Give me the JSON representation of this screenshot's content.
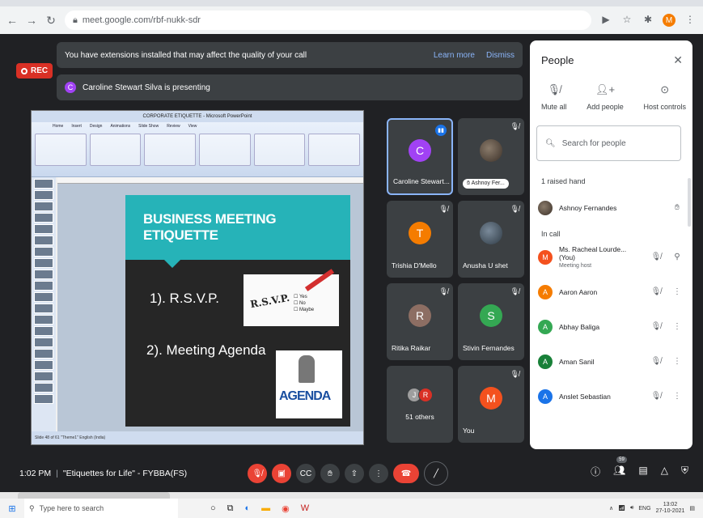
{
  "browser": {
    "url": "meet.google.com/rbf-nukk-sdr",
    "profile_initial": "M"
  },
  "rec_label": "REC",
  "banners": {
    "extensions": "You have extensions installed that may affect the quality of your call",
    "learn_more": "Learn more",
    "dismiss": "Dismiss",
    "presenter_initial": "C",
    "presenting": "Caroline Stewart Silva is presenting"
  },
  "presentation": {
    "window_title": "CORPORATE ETIQUETTE - Microsoft PowerPoint",
    "ribbon_tabs": [
      "Home",
      "Insert",
      "Design",
      "Animations",
      "Slide Show",
      "Review",
      "View"
    ],
    "slide_title": "BUSINESS MEETING ETIQUETTE",
    "item1": "1). R.S.V.P.",
    "item2": "2). Meeting Agenda",
    "rsvp_title": "R.S.V.P.",
    "rsvp_options": [
      "Yes",
      "No",
      "Maybe"
    ],
    "agenda_image_text": "AGENDA",
    "status": "Slide 48 of 61   \"Theme1\"   English (India)"
  },
  "tiles": [
    {
      "name": "Caroline Stewart...",
      "initial": "C",
      "color": "#a142f4"
    },
    {
      "name": "Ashnoy Fer..."
    },
    {
      "name": "Trishia D'Mello",
      "initial": "T",
      "color": "#f57c00"
    },
    {
      "name": "Anusha U shet"
    },
    {
      "name": "Ritika Raikar",
      "initial": "R",
      "color": "#8d6e63"
    },
    {
      "name": "Stivin Fernandes",
      "initial": "S",
      "color": "#34a853"
    },
    {
      "name": "51 others",
      "initials": [
        "J",
        "R"
      ]
    },
    {
      "name": "You",
      "initial": "M",
      "color": "#f4511e"
    }
  ],
  "people_panel": {
    "title": "People",
    "actions": [
      {
        "label": "Mute all",
        "icon": "mic-off-icon"
      },
      {
        "label": "Add people",
        "icon": "add-person-icon"
      },
      {
        "label": "Host controls",
        "icon": "host-controls-icon"
      }
    ],
    "search_placeholder": "Search for people",
    "raised_hand_label": "1 raised hand",
    "raised": {
      "name": "Ashnoy Fernandes"
    },
    "in_call_label": "In call",
    "people": [
      {
        "name": "Ms. Racheal Lourde... (You)",
        "sub": "Meeting host",
        "initial": "M",
        "color": "#f4511e"
      },
      {
        "name": "Aaron Aaron",
        "initial": "A",
        "color": "#f57c00"
      },
      {
        "name": "Abhay Baliga",
        "initial": "A",
        "color": "#34a853"
      },
      {
        "name": "Aman Sanil",
        "initial": "A",
        "color": "#188038"
      },
      {
        "name": "Anslet Sebastian",
        "initial": "A",
        "color": "#1a73e8"
      }
    ]
  },
  "controls": {
    "time": "1:02 PM",
    "meeting_name": "\"Etiquettes for Life\" - FYBBA(FS)",
    "participant_count": "59"
  },
  "taskbar": {
    "search_placeholder": "Type here to search",
    "lang": "ENG",
    "time": "13:02",
    "date": "27-10-2021"
  }
}
